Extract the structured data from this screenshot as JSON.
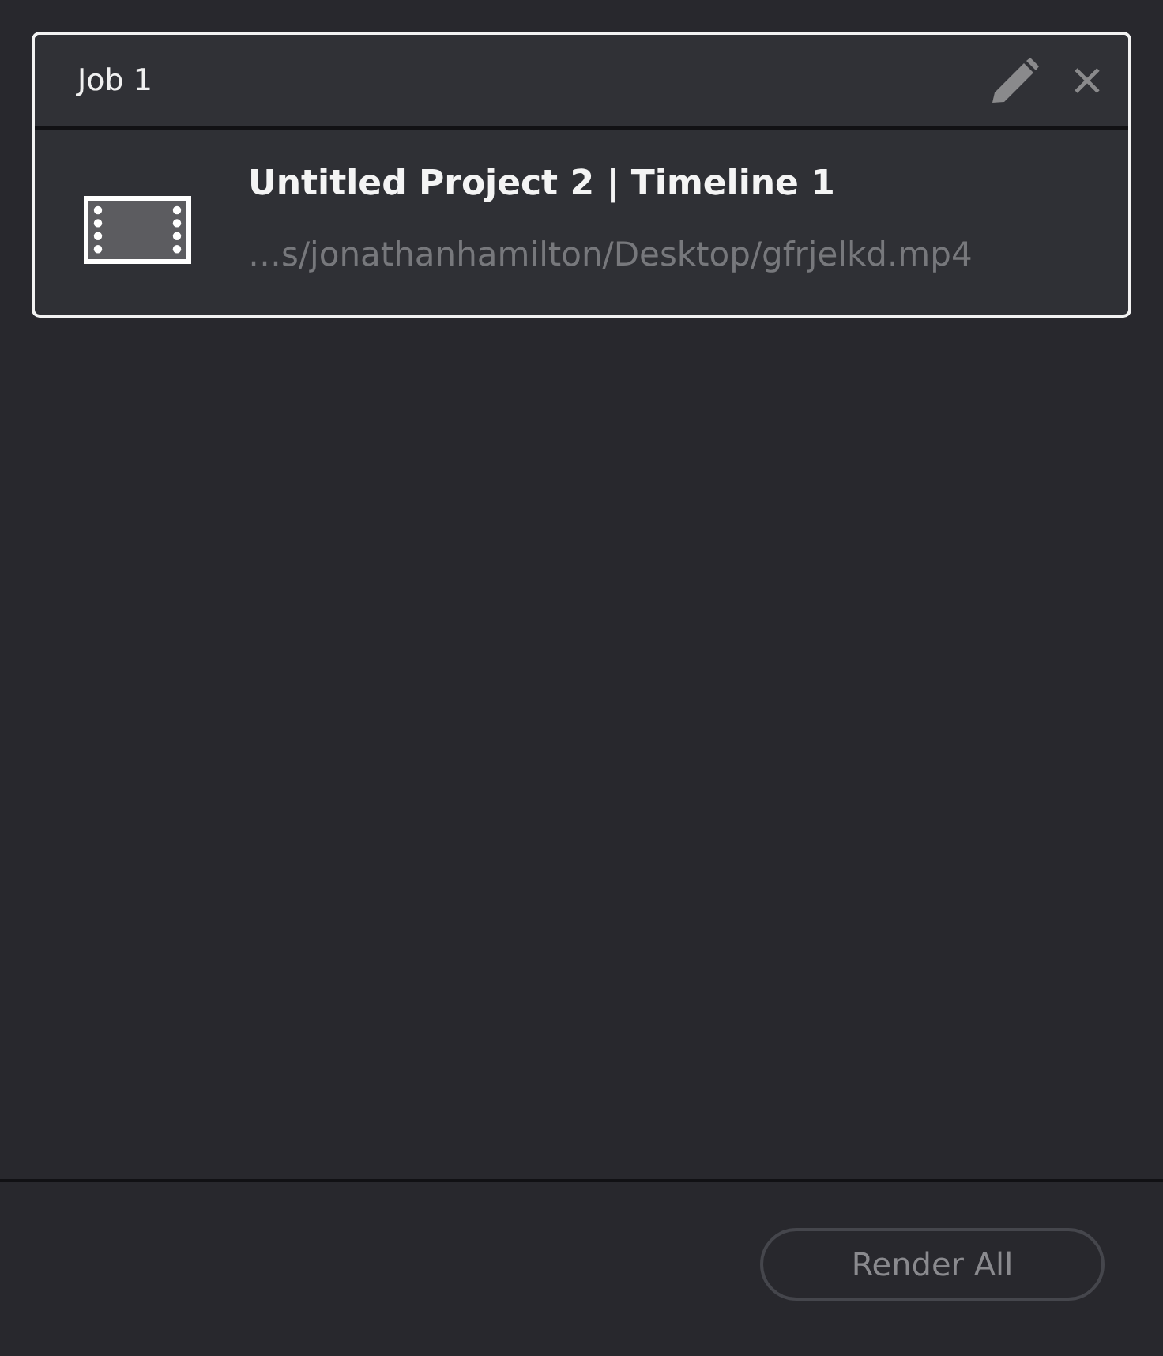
{
  "jobs": [
    {
      "title": "Job 1",
      "selected": true,
      "name": "Untitled Project 2 | Timeline 1",
      "path": "…s/jonathanhamilton/Desktop/gfrjelkd.mp4"
    }
  ],
  "footer": {
    "button": "Render All"
  }
}
